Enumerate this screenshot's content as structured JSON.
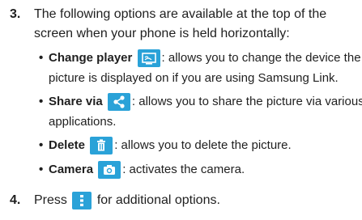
{
  "step3": {
    "number": "3.",
    "line1": "The following options are available at the top of the",
    "line2": "screen when your phone is held horizontally:"
  },
  "bullets": [
    {
      "term": "Change player",
      "icon": "screen-mirror-icon",
      "line1": ": allows you to change the device the",
      "line2": "picture is displayed on if you are using Samsung Link."
    },
    {
      "term": "Share via",
      "icon": "share-icon",
      "line1": ": allows you to share the picture via various",
      "line2": "applications."
    },
    {
      "term": "Delete",
      "icon": "trash-icon",
      "line1": ": allows you to delete the picture."
    },
    {
      "term": "Camera",
      "icon": "camera-icon",
      "line1": ": activates the camera."
    }
  ],
  "step4": {
    "number": "4.",
    "before": "Press",
    "icon": "menu-icon",
    "after": "for additional options."
  },
  "colors": {
    "icon_bg": "#2aa2d8",
    "text": "#1f1f1f"
  }
}
